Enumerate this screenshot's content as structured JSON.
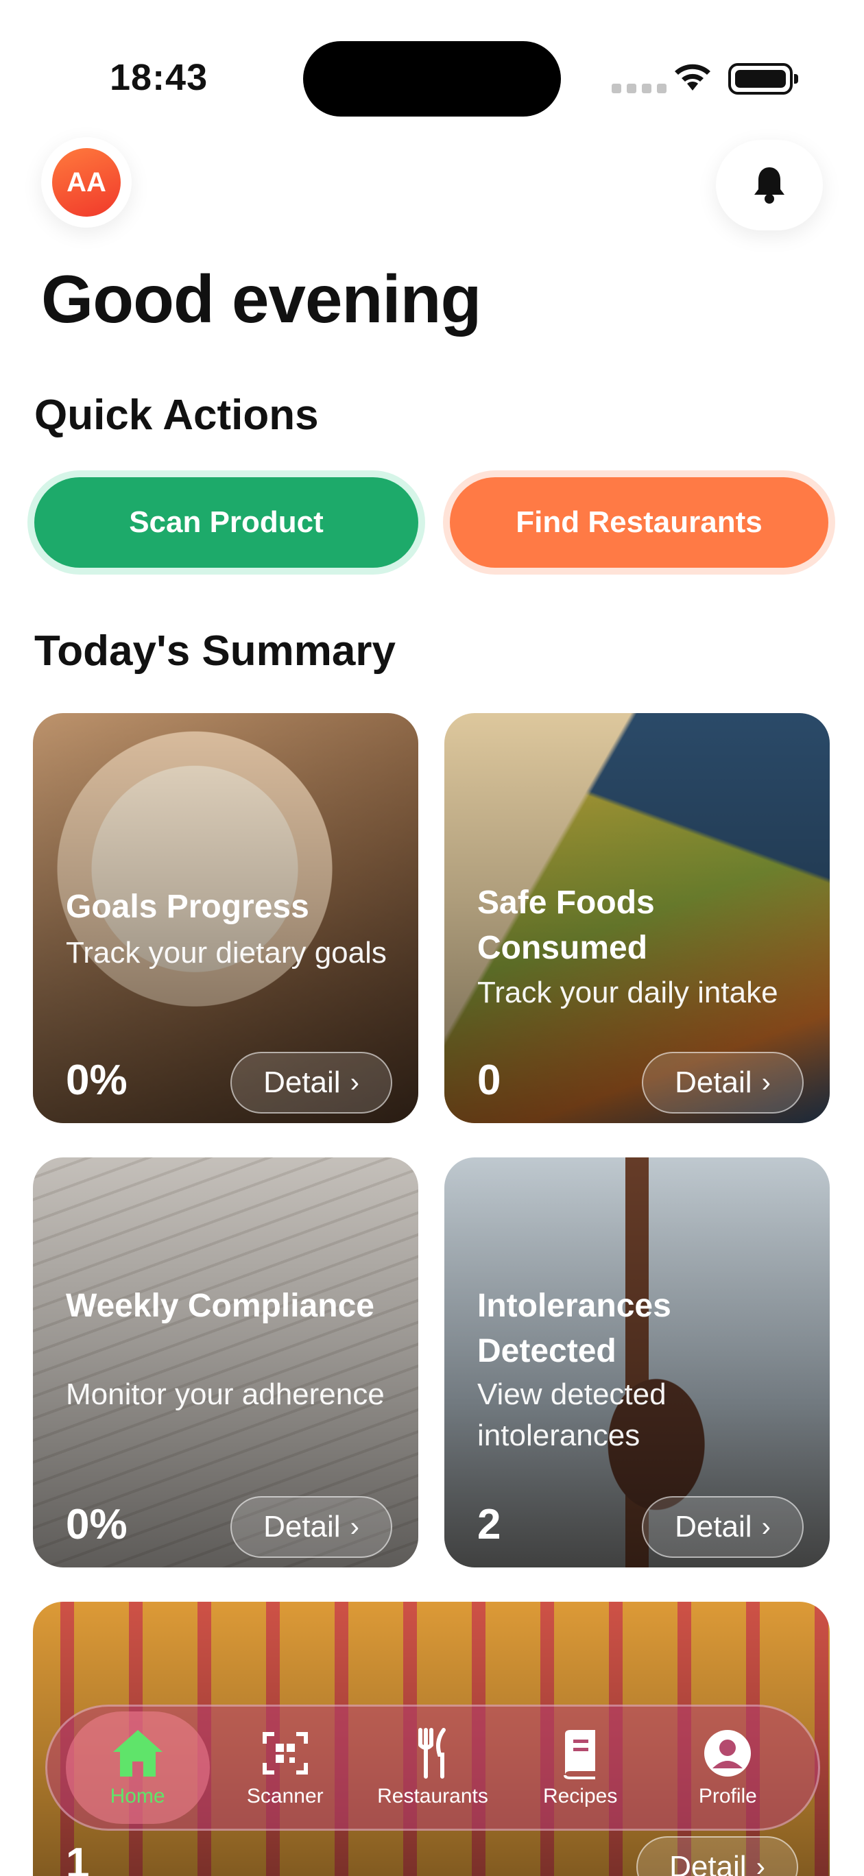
{
  "status_bar": {
    "time": "18:43"
  },
  "header": {
    "avatar_initials": "AA",
    "greeting": "Good evening"
  },
  "quick_actions": {
    "title": "Quick Actions",
    "scan_label": "Scan Product",
    "restaurants_label": "Find Restaurants"
  },
  "summary": {
    "title": "Today's Summary",
    "detail_label": "Detail",
    "cards": [
      {
        "title": "Goals Progress",
        "subtitle": "Track your dietary goals",
        "value": "0%"
      },
      {
        "title": "Safe Foods Consumed",
        "subtitle": "Track your daily intake",
        "value": "0"
      },
      {
        "title": "Weekly Compliance",
        "subtitle": "Monitor your adherence",
        "value": "0%"
      },
      {
        "title": "Intolerances Detected",
        "subtitle": "View detected intolerances",
        "value": "2"
      }
    ],
    "partial_card_value": "1"
  },
  "nav": {
    "items": [
      {
        "label": "Home",
        "icon": "home-icon",
        "active": true
      },
      {
        "label": "Scanner",
        "icon": "qr-scan-icon"
      },
      {
        "label": "Restaurants",
        "icon": "fork-knife-icon"
      },
      {
        "label": "Recipes",
        "icon": "book-icon"
      },
      {
        "label": "Profile",
        "icon": "user-circle-icon"
      }
    ]
  },
  "colors": {
    "scan_green": "#1daa6a",
    "restaurant_orange": "#ff7a45",
    "active_nav": "#5fe46a"
  }
}
